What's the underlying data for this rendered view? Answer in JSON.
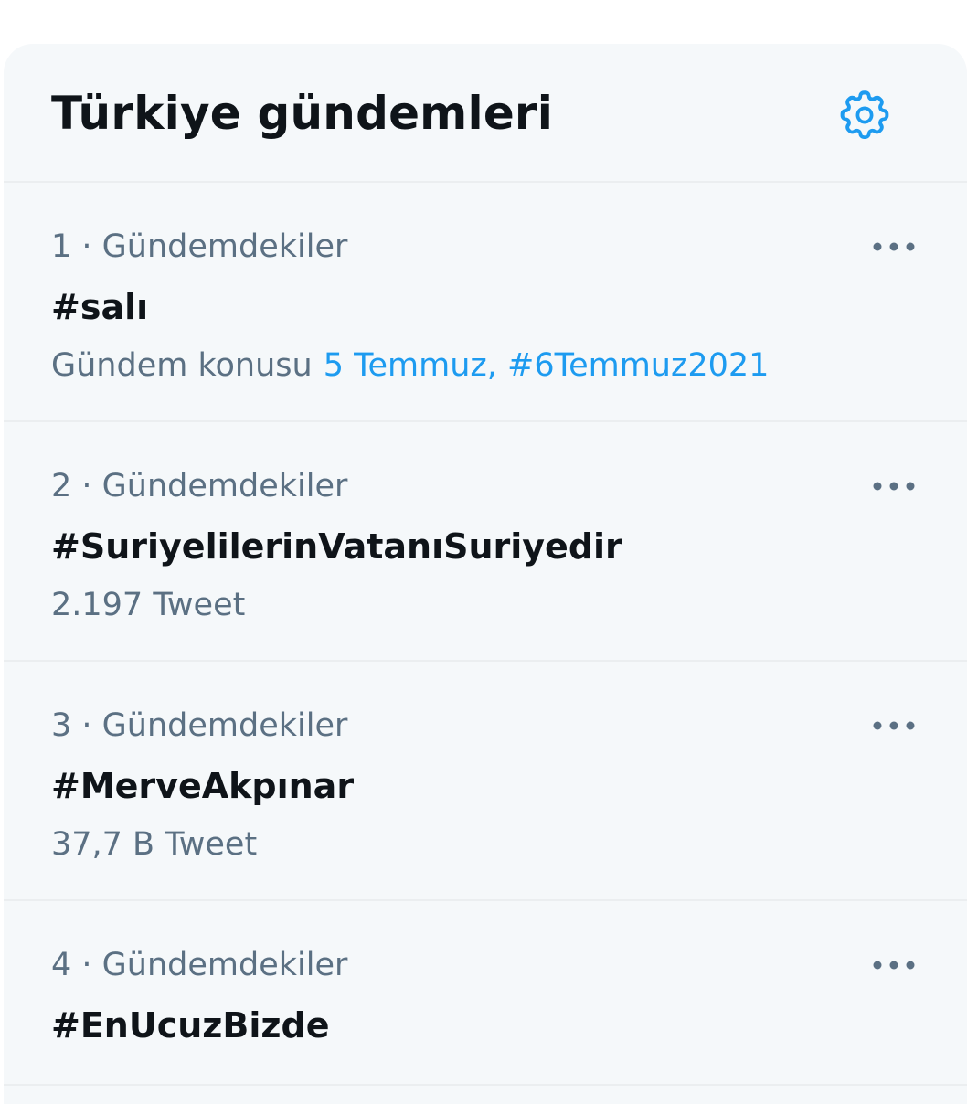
{
  "header": {
    "title": "Türkiye gündemleri",
    "settings_icon": "gear-icon"
  },
  "colors": {
    "accent": "#1d9bf0",
    "secondary_text": "#5b7083",
    "panel_bg": "#f5f8fa"
  },
  "trends": [
    {
      "meta": "1 · Gündemdekiler",
      "name": "#salı",
      "sub_label": "Gündem konusu",
      "sub_links": "5 Temmuz, #6Temmuz2021",
      "more_icon": "more-dots-icon"
    },
    {
      "meta": "2 · Gündemdekiler",
      "name": "#SuriyelilerinVatanıSuriyedir",
      "tweet_count": "2.197 Tweet",
      "more_icon": "more-dots-icon"
    },
    {
      "meta": "3 · Gündemdekiler",
      "name": "#MerveAkpınar",
      "tweet_count": "37,7 B Tweet",
      "more_icon": "more-dots-icon"
    },
    {
      "meta": "4 · Gündemdekiler",
      "name": "#EnUcuzBizde",
      "more_icon": "more-dots-icon"
    }
  ]
}
